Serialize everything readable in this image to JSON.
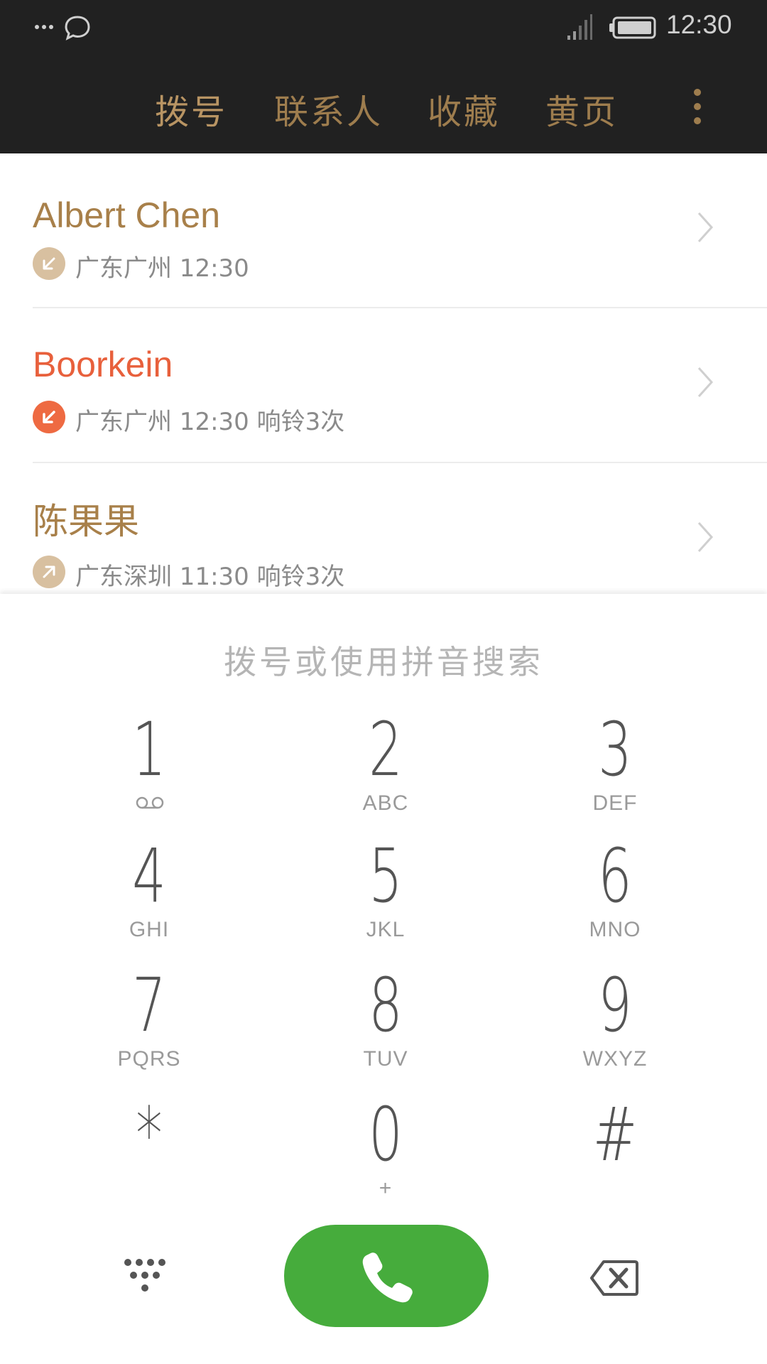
{
  "status_bar": {
    "time": "12:30",
    "icons": [
      "more-dots-icon",
      "chat-bubble-icon",
      "signal-icon",
      "battery-icon"
    ]
  },
  "tabs": [
    {
      "label": "拨号",
      "active": true
    },
    {
      "label": "联系人",
      "active": false
    },
    {
      "label": "收藏",
      "active": false
    },
    {
      "label": "黄页",
      "active": false
    }
  ],
  "calls": [
    {
      "name": "Albert Chen",
      "type": "incoming",
      "detail": "广东广州  12:30"
    },
    {
      "name": "Boorkein",
      "type": "missed",
      "detail": "广东广州  12:30  响铃3次"
    },
    {
      "name": "陈果果",
      "type": "outgoing",
      "detail": "广东深圳  11:30  响铃3次"
    }
  ],
  "dialer": {
    "search_placeholder": "拨号或使用拼音搜索",
    "keys": [
      {
        "num": "1",
        "sub": "",
        "icon": "voicemail-icon"
      },
      {
        "num": "2",
        "sub": "ABC"
      },
      {
        "num": "3",
        "sub": "DEF"
      },
      {
        "num": "4",
        "sub": "GHI"
      },
      {
        "num": "5",
        "sub": "JKL"
      },
      {
        "num": "6",
        "sub": "MNO"
      },
      {
        "num": "7",
        "sub": "PQRS"
      },
      {
        "num": "8",
        "sub": "TUV"
      },
      {
        "num": "9",
        "sub": "WXYZ"
      },
      {
        "num": "*",
        "sub": ""
      },
      {
        "num": "0",
        "sub": "+"
      },
      {
        "num": "#",
        "sub": ""
      }
    ]
  },
  "colors": {
    "topbar": "#212121",
    "tab_text": "#9e7d4e",
    "missed": "#e8603c",
    "call_button": "#46ac3c"
  }
}
